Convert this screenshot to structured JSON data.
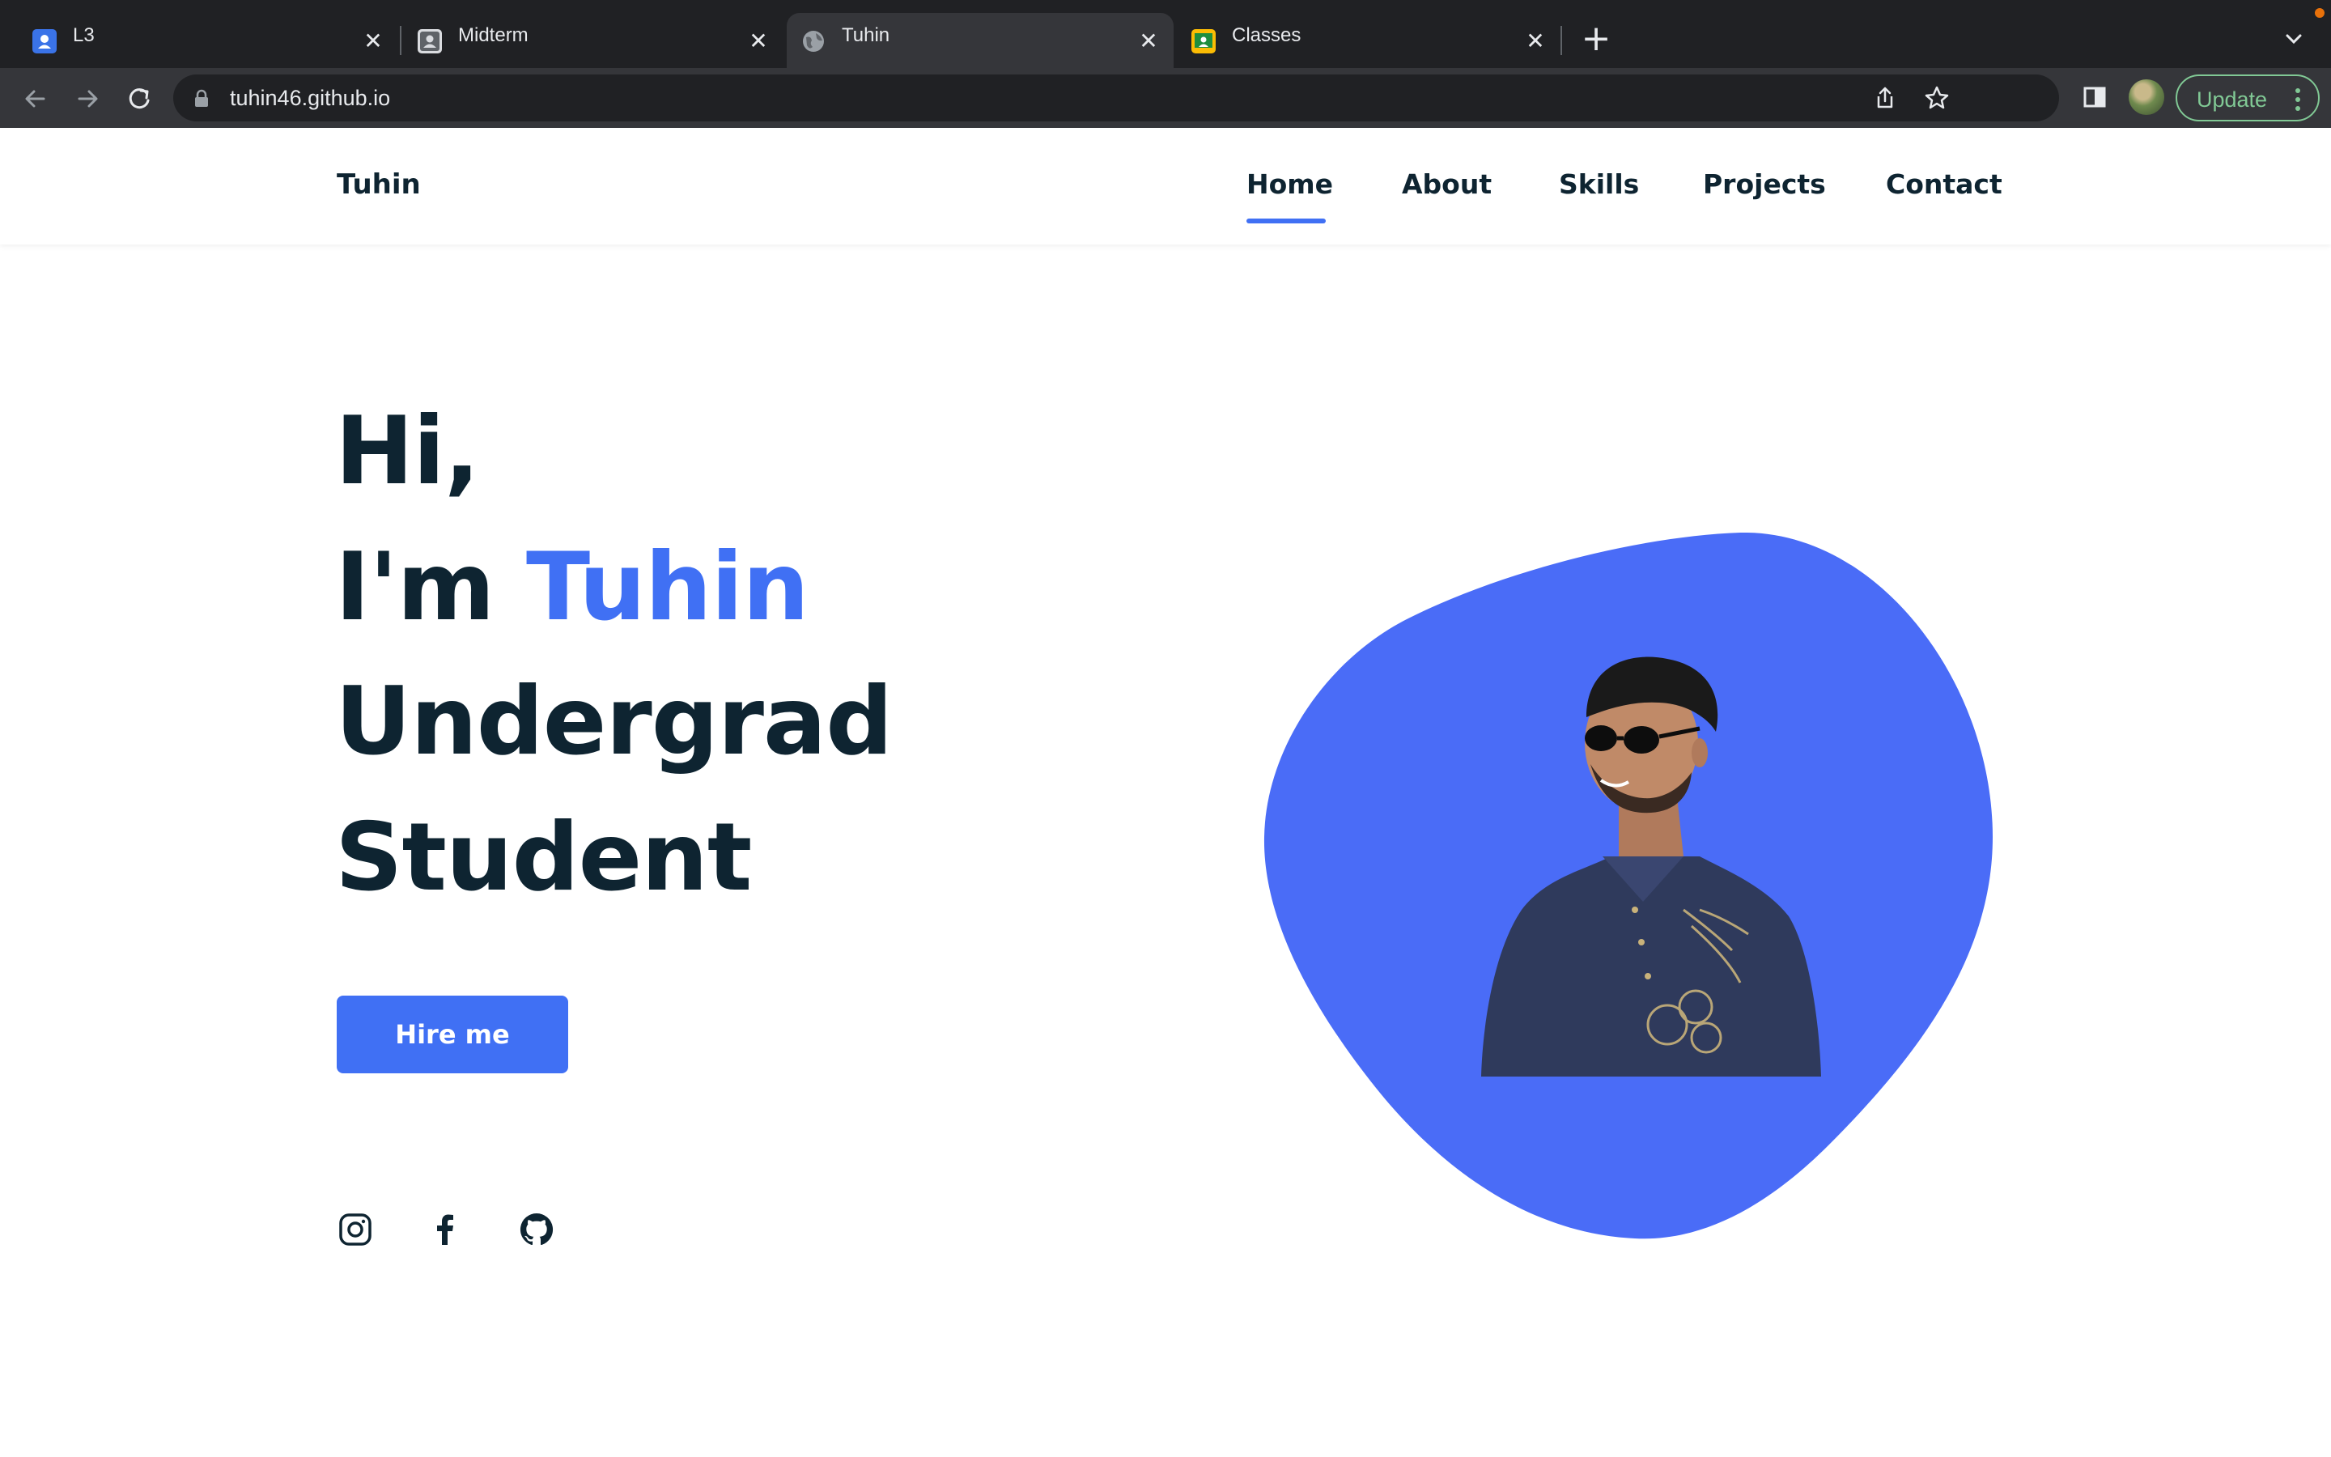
{
  "browser": {
    "tabs": [
      {
        "title": "L3",
        "favicon": "classroom-blue-icon"
      },
      {
        "title": "Midterm",
        "favicon": "classroom-gray-icon"
      },
      {
        "title": "Tuhin",
        "favicon": "globe-icon",
        "active": true
      },
      {
        "title": "Classes",
        "favicon": "classroom-icon"
      }
    ],
    "url": "tuhin46.github.io",
    "update_label": "Update"
  },
  "site": {
    "logo": "Tuhin",
    "nav": [
      "Home",
      "About",
      "Skills",
      "Projects",
      "Contact"
    ],
    "active_nav": "Home",
    "hero": {
      "line1": "Hi,",
      "line2_prefix": "I'm ",
      "line2_name": "Tuhin",
      "line3": "Undergrad",
      "line4": "Student"
    },
    "cta": "Hire me",
    "social": [
      "instagram-icon",
      "facebook-icon",
      "github-icon"
    ],
    "colors": {
      "accent": "#4070f4",
      "text": "#0e2431"
    }
  }
}
